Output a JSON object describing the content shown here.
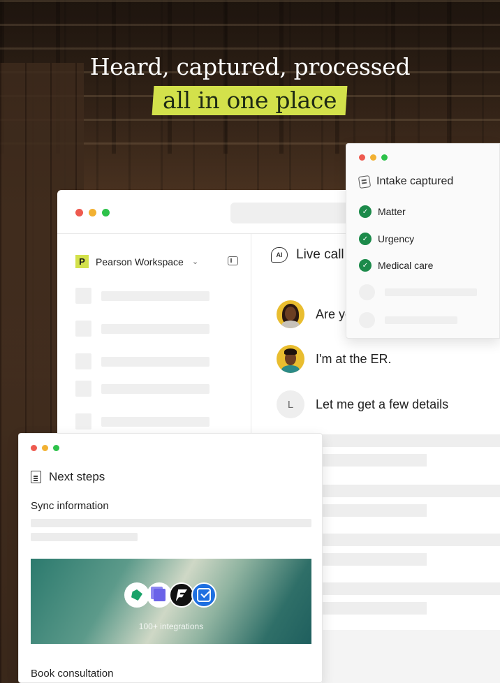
{
  "headline": {
    "line1": "Heard, captured, processed",
    "line2": "all in one place"
  },
  "workspace": {
    "name": "Pearson Workspace",
    "logo_letter": "P"
  },
  "live_call": {
    "title": "Live call",
    "ai_badge": "AI",
    "messages": [
      {
        "text": "Are you",
        "avatar": "woman-avatar"
      },
      {
        "text": "I'm at the ER.",
        "avatar": "man-avatar"
      },
      {
        "text": "Let me get a few details",
        "avatar_letter": "L"
      }
    ]
  },
  "intake": {
    "title": "Intake captured",
    "items": [
      "Matter",
      "Urgency",
      "Medical care"
    ]
  },
  "next_steps": {
    "title": "Next steps",
    "sync_label": "Sync information",
    "integrations_caption": "100+ integrations",
    "book_label": "Book consultation"
  },
  "colors": {
    "accent_highlight": "#d3e14b",
    "check_green": "#1c8a4a",
    "dot_red": "#ee5a4f",
    "dot_yellow": "#f2b132",
    "dot_green": "#2dc24a"
  },
  "icons": [
    "ai-chat-icon",
    "document-stack-icon",
    "page-icon",
    "check-icon",
    "panel-toggle-icon",
    "chevron-down-icon"
  ]
}
